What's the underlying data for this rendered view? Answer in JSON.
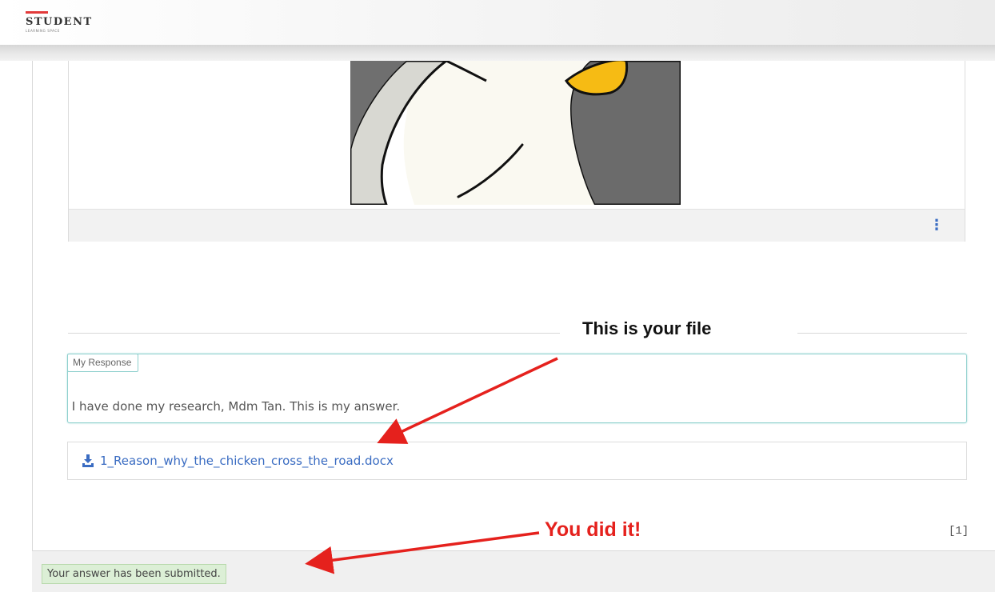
{
  "header": {
    "logo_title": "STUDENT",
    "logo_subtitle": "LEARNING SPACE"
  },
  "image_card": {
    "image_icon": "penguin-illustration",
    "menu_icon": "kebab-menu-icon",
    "menu_glyph": "⋮"
  },
  "annotations": {
    "file_note": "This is your file",
    "success_note": "You did it!",
    "arrow_color": "#e5211d"
  },
  "response": {
    "label": "My Response",
    "text": "I have done my research, Mdm Tan. This is my answer."
  },
  "attachment": {
    "icon": "download-icon",
    "filename": "1_Reason_why_the_chicken_cross_the_road.docx"
  },
  "score": {
    "text": "[1]"
  },
  "status": {
    "message": "Your answer has been submitted."
  },
  "colors": {
    "link": "#3a6cc2",
    "response_border": "#8fd0ce",
    "success_bg": "#dcefd6",
    "annotation_red": "#e5211d"
  }
}
